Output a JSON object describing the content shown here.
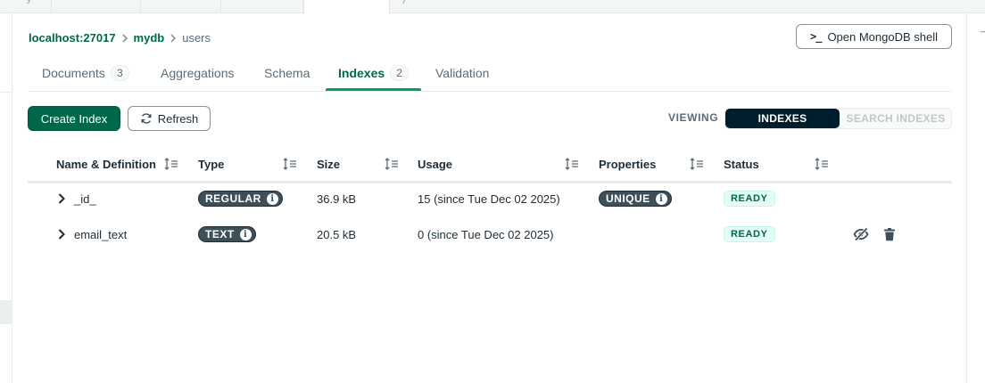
{
  "breadcrumb": {
    "host": "localhost:27017",
    "db": "mydb",
    "collection": "users"
  },
  "shell_button": {
    "icon": "terminal-prompt-icon",
    "label": "Open MongoDB shell"
  },
  "tabs": [
    {
      "label": "Documents",
      "count": "3"
    },
    {
      "label": "Aggregations",
      "count": ""
    },
    {
      "label": "Schema",
      "count": ""
    },
    {
      "label": "Indexes",
      "count": "2"
    },
    {
      "label": "Validation",
      "count": ""
    }
  ],
  "active_tab": "Indexes",
  "toolbar": {
    "create_label": "Create Index",
    "refresh_label": "Refresh",
    "viewing_label": "VIEWING",
    "view_options": [
      "INDEXES",
      "SEARCH INDEXES"
    ],
    "selected_view": "INDEXES"
  },
  "table": {
    "columns": [
      "Name & Definition",
      "Type",
      "Size",
      "Usage",
      "Properties",
      "Status"
    ],
    "rows": [
      {
        "name": "_id_",
        "type": "REGULAR",
        "size": "36.9 kB",
        "usage": "15 (since Tue Dec 02 2025)",
        "property": "UNIQUE",
        "status": "READY",
        "show_actions": false
      },
      {
        "name": "email_text",
        "type": "TEXT",
        "size": "20.5 kB",
        "usage": "0 (since Tue Dec 02 2025)",
        "property": "",
        "status": "READY",
        "show_actions": true
      }
    ]
  },
  "colors": {
    "brand_green": "#00684a",
    "accent_green": "#00a35c",
    "dark": "#001e2b",
    "pill": "#3d4f58",
    "status_bg": "#e3fcf7"
  },
  "icons": [
    "chevron-right-icon",
    "sort-icon",
    "refresh-icon",
    "info-icon",
    "hide-icon",
    "trash-icon",
    "terminal-prompt-icon"
  ]
}
